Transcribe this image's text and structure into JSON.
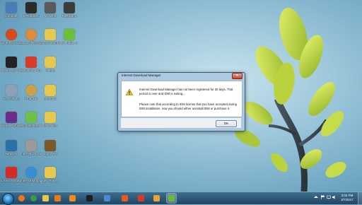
{
  "desktop": {
    "icons": [
      {
        "label": "Computer",
        "color": "#4a7db5"
      },
      {
        "label": "K7TotalSec",
        "color": "#2b2b2b"
      },
      {
        "label": "My Web",
        "color": "#5a5a5a"
      },
      {
        "label": "FastStone",
        "color": "#3c3c3c"
      },
      {
        "label": "Screenshot Gnome",
        "color": "#d64a1e"
      },
      {
        "label": "Launch Recovery",
        "color": "#e08a3c"
      },
      {
        "label": "mouse record",
        "color": "#e6c84c"
      },
      {
        "label": "dw_riddle_jr",
        "color": "#6bbf3a"
      },
      {
        "label": "VIDEO BO Video C",
        "color": "#222222"
      },
      {
        "label": "CleverTop Pro",
        "color": "#d93a2a"
      },
      {
        "label": "videos",
        "color": "#e6c84c"
      },
      {
        "label": "Recycle Bin",
        "color": "#8aa0b5"
      },
      {
        "label": "Proto DD",
        "color": "#c9a24a"
      },
      {
        "label": "personal",
        "color": "#e6c84c"
      },
      {
        "label": "Adobe Premiere Pr",
        "color": "#6a2d8c"
      },
      {
        "label": "Wondershare Photo",
        "color": "#6fbf4a"
      },
      {
        "label": "office files",
        "color": "#e6c84c"
      },
      {
        "label": "Network",
        "color": "#2f6fa8"
      },
      {
        "label": "Internet Download",
        "color": "#9a9a9a"
      },
      {
        "label": "adobe FW",
        "color": "#7a5a2a"
      },
      {
        "label": "CASIO Manager",
        "color": "#d42a2a"
      },
      {
        "label": "Internet Manager",
        "color": "#3a8fd0"
      },
      {
        "label": "New Folder",
        "color": "#e6c84c"
      }
    ]
  },
  "dialog": {
    "title": "Internet Download Manager",
    "close_label": "✕",
    "message_line1": "Internet Download Manager has not been registered for 30 days. Trial period is over and IDM is exiting...",
    "message_line2": "Please note that according to IDM license that you have accepted during IDM installation, now you should either uninstall IDM or purchase it.",
    "ok_label": "OK"
  },
  "taskbar": {
    "pinned": [
      {
        "name": "firefox",
        "color": "#e8781e"
      },
      {
        "name": "chrome",
        "color": "#3a9a4a"
      },
      {
        "name": "file-explorer",
        "color": "#e6c84c"
      },
      {
        "name": "media-player",
        "color": "#e67a1e"
      },
      {
        "name": "vlc",
        "color": "#f08a1e"
      },
      {
        "name": "k7",
        "color": "#1e1e1e"
      },
      {
        "name": "paint",
        "color": "#4a8ad0"
      },
      {
        "name": "app-orange",
        "color": "#e85a1e"
      },
      {
        "name": "app-red",
        "color": "#d83a2a"
      },
      {
        "name": "app-sq",
        "color": "#e8a43a"
      },
      {
        "name": "idm",
        "color": "#6ab83a"
      }
    ],
    "time": "2:02 PM",
    "date": "3/7/2017"
  }
}
